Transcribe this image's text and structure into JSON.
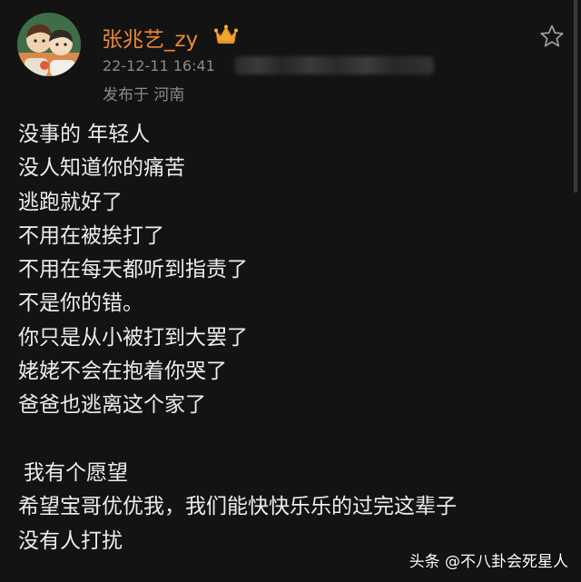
{
  "post": {
    "author": "张兆艺_zy",
    "timestamp": "22-12-11 16:41",
    "location": "发布于 河南",
    "lines_part1": [
      "没事的 年轻人",
      "没人知道你的痛苦",
      "逃跑就好了",
      "不用在被挨打了",
      "不用在每天都听到指责了",
      "不是你的错。",
      "你只是从小被打到大罢了",
      "姥姥不会在抱着你哭了",
      "爸爸也逃离这个家了"
    ],
    "lines_part2": [
      "我有个愿望",
      "希望宝哥优优我，我们能快快乐乐的过完这辈子",
      "没有人打扰"
    ]
  },
  "watermark": "头条 @不八卦会死星人",
  "colors": {
    "background": "#131313",
    "author": "#f08a2a",
    "meta": "#8a8a8a",
    "text": "#ededed"
  },
  "icons": {
    "badge": "crown-icon",
    "favorite": "star-icon"
  }
}
